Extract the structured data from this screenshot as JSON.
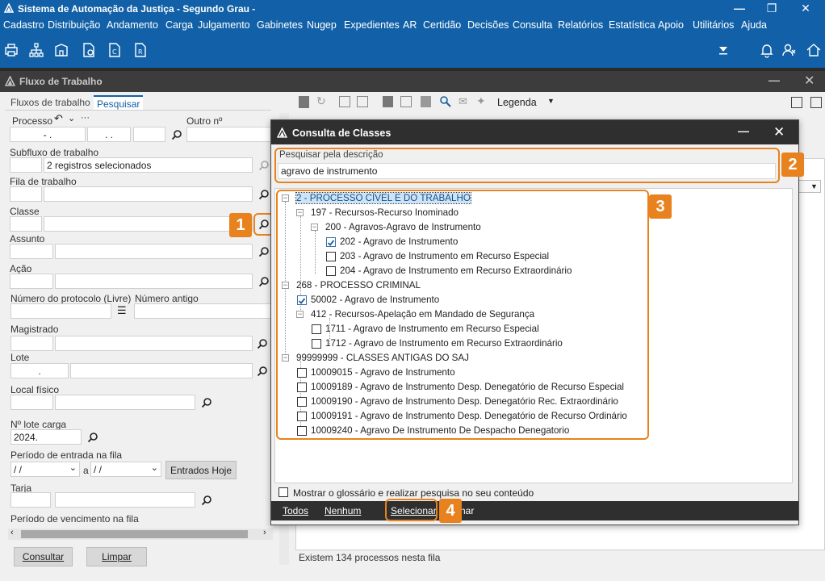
{
  "window": {
    "title": "Sistema de Automação da Justiça - Segundo Grau -"
  },
  "menu": [
    "Cadastro",
    "Distribuição",
    "Andamento",
    "Carga",
    "Julgamento",
    "Gabinetes",
    "Nugep",
    "Expedientes",
    "AR",
    "Certidão",
    "Decisões",
    "Consulta",
    "Relatórios",
    "Estatística",
    "Apoio",
    "Utilitários",
    "Ajuda"
  ],
  "panel": {
    "title": "Fluxo de Trabalho"
  },
  "left": {
    "tabs": [
      "Fluxos de trabalho",
      "Pesquisar"
    ],
    "processo_label": "Processo",
    "outro_label": "Outro nº",
    "processo_val1": "- .",
    "processo_val2": ". .",
    "subfluxo_label": "Subfluxo de trabalho",
    "subfluxo_value": "2 registros selecionados",
    "fila_label": "Fila de trabalho",
    "classe_label": "Classe",
    "assunto_label": "Assunto",
    "acao_label": "Ação",
    "protocolo_label": "Número do protocolo (Livre)",
    "antigo_label": "Número antigo",
    "magistrado_label": "Magistrado",
    "lote_label": "Lote",
    "lote_value": ".",
    "local_label": "Local físico",
    "lote_carga_label": "Nº lote carga",
    "lote_carga_value": "2024.",
    "periodo_label": "Período de entrada na fila",
    "date1": "/ /",
    "date_sep": "a",
    "date2": "/ /",
    "entrados_hoje": "Entrados Hoje",
    "tarja_label": "Tarja",
    "vencimento_label": "Período de vencimento na fila",
    "consultar": "Consultar",
    "limpar": "Limpar"
  },
  "right": {
    "legenda": "Legenda",
    "status": "Existem 134 processos nesta fila"
  },
  "dialog": {
    "title": "Consulta de Classes",
    "search_label": "Pesquisar pela descrição",
    "search_value": "agravo de instrumento",
    "tree": [
      {
        "label": "2 - PROCESSO CÍVEL E DO TRABALHO",
        "level": 0,
        "checkbox": false,
        "checked": false,
        "selected": true
      },
      {
        "label": "197 - Recursos-Recurso Inominado",
        "level": 1,
        "checkbox": false,
        "checked": false
      },
      {
        "label": "200 - Agravos-Agravo de Instrumento",
        "level": 2,
        "checkbox": false,
        "checked": false
      },
      {
        "label": "202 - Agravo de Instrumento",
        "level": 3,
        "checkbox": true,
        "checked": true
      },
      {
        "label": "203 - Agravo de Instrumento em Recurso Especial",
        "level": 3,
        "checkbox": true,
        "checked": false
      },
      {
        "label": "204 - Agravo de Instrumento em Recurso Extraordinário",
        "level": 3,
        "checkbox": true,
        "checked": false
      },
      {
        "label": "268 - PROCESSO CRIMINAL",
        "level": 0,
        "checkbox": false,
        "checked": false
      },
      {
        "label": "50002 - Agravo de Instrumento",
        "level": 1,
        "checkbox": true,
        "checked": true
      },
      {
        "label": "412 - Recursos-Apelação em Mandado de Segurança",
        "level": 1,
        "checkbox": false,
        "checked": false
      },
      {
        "label": "1711 - Agravo de Instrumento em Recurso Especial",
        "level": 2,
        "checkbox": true,
        "checked": false
      },
      {
        "label": "1712 - Agravo de Instrumento em Recurso Extraordinário",
        "level": 2,
        "checkbox": true,
        "checked": false
      },
      {
        "label": "99999999 - CLASSES ANTIGAS DO SAJ",
        "level": 0,
        "checkbox": false,
        "checked": false
      },
      {
        "label": "10009015 - Agravo de Instrumento",
        "level": 1,
        "checkbox": true,
        "checked": false
      },
      {
        "label": "10009189 - Agravo de Instrumento Desp. Denegatório de Recurso Especial",
        "level": 1,
        "checkbox": true,
        "checked": false
      },
      {
        "label": "10009190 - Agravo de Instrumento Desp. Denegatório Rec. Extraordinário",
        "level": 1,
        "checkbox": true,
        "checked": false
      },
      {
        "label": "10009191 - Agravo de Instrumento Desp. Denegatório de Recurso Ordinário",
        "level": 1,
        "checkbox": true,
        "checked": false
      },
      {
        "label": "10009240 - Agravo De Instrumento De Despacho Denegatorio",
        "level": 1,
        "checkbox": true,
        "checked": false
      }
    ],
    "glossario": "Mostrar o glossário e realizar pesquisa no seu conteúdo",
    "todos": "Todos",
    "nenhum": "Nenhum",
    "selecionar": "Selecionar",
    "fechar_partial": "har"
  },
  "badges": [
    "1",
    "2",
    "3",
    "4"
  ],
  "colors": {
    "accent": "#1261a8",
    "highlight": "#e8821e"
  }
}
